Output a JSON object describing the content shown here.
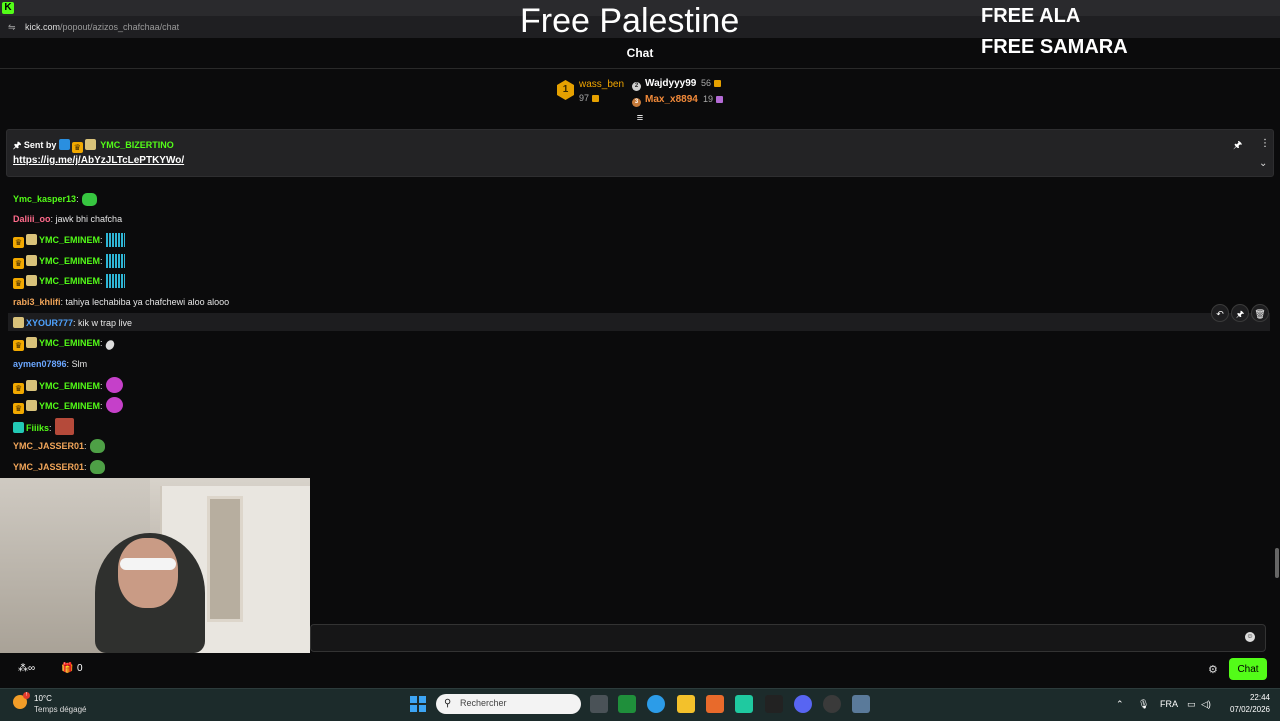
{
  "browser": {
    "logo_letter": "K",
    "url_host": "kick.com",
    "url_path": "/popout/azizos_chafchaa/chat"
  },
  "overlay": {
    "title": "Free Palestine",
    "line1": "FREE ALA",
    "line2": "FREE SAMARA"
  },
  "chat": {
    "title": "Chat",
    "leaderboard": {
      "first": {
        "rank": "1",
        "name": "wass_ben",
        "count": "97"
      },
      "second": {
        "name": "Wajdyyy99",
        "count": "56"
      },
      "third": {
        "name": "Max_x8894",
        "count": "19"
      }
    },
    "pinned": {
      "sent_by_label": "Sent by",
      "user": "YMC_BIZERTINO",
      "link": "https://ig.me/j/AbYzJLTcLePTKYWo/"
    },
    "messages": [
      {
        "user": "Ymc_kasper13",
        "text": "",
        "emote": "green",
        "color": "#53fc18"
      },
      {
        "user": "Daliii_oo",
        "text": " jawk bhi chafcha",
        "emote": "",
        "color": "#ff6b8b"
      },
      {
        "user": "YMC_EMINEM",
        "text": "",
        "emote": "bars",
        "color": "#53fc18"
      },
      {
        "user": "YMC_EMINEM",
        "text": "",
        "emote": "bars",
        "color": "#53fc18"
      },
      {
        "user": "YMC_EMINEM",
        "text": "",
        "emote": "bars",
        "color": "#53fc18"
      },
      {
        "user": "rabi3_khlifi",
        "text": " tahiya lechabiba ya chafchewi aloo alooo",
        "emote": "",
        "color": "#f2a65a"
      },
      {
        "user": "XYOUR777",
        "text": " kik w trap live",
        "emote": "",
        "color": "#4fa3ff"
      },
      {
        "user": "YMC_EMINEM",
        "text": "",
        "emote": "white",
        "color": "#53fc18"
      },
      {
        "user": "aymen07896",
        "text": " Slm",
        "emote": "",
        "color": "#6aa6ff"
      },
      {
        "user": "YMC_EMINEM",
        "text": "",
        "emote": "pink",
        "color": "#53fc18"
      },
      {
        "user": "YMC_EMINEM",
        "text": "",
        "emote": "pink",
        "color": "#53fc18"
      },
      {
        "user": "Fiiiks",
        "text": "",
        "emote": "red",
        "color": "#53fc18"
      },
      {
        "user": "YMC_JASSER01",
        "text": "",
        "emote": "frog",
        "color": "#f2a65a"
      },
      {
        "user": "YMC_JASSER01",
        "text": "",
        "emote": "frog",
        "color": "#f2a65a"
      }
    ],
    "bottom_count": "0",
    "send_label": "Chat"
  },
  "taskbar": {
    "temperature": "10°C",
    "weather": "Temps dégagé",
    "search_placeholder": "Rechercher",
    "language": "FRA",
    "time": "22:44",
    "date": "07/02/2026"
  },
  "colors": {
    "kick_green": "#53fc18",
    "gold": "#e6a100"
  }
}
